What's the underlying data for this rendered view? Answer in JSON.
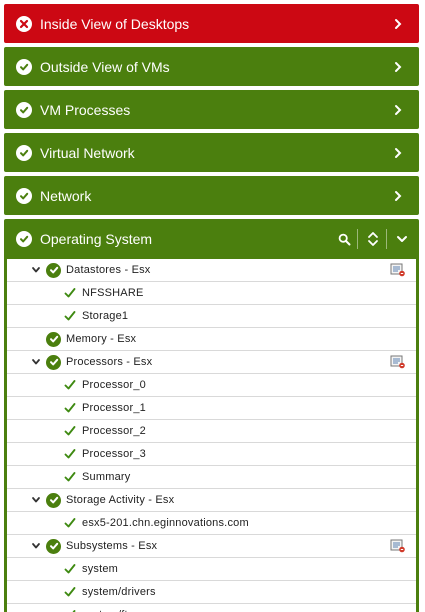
{
  "sections": [
    {
      "label": "Inside View of Desktops",
      "status": "error"
    },
    {
      "label": "Outside View of VMs",
      "status": "ok"
    },
    {
      "label": "VM Processes",
      "status": "ok"
    },
    {
      "label": "Virtual Network",
      "status": "ok"
    },
    {
      "label": "Network",
      "status": "ok"
    }
  ],
  "expanded_section": {
    "label": "Operating System",
    "status": "ok",
    "tools": [
      "search-icon",
      "sort-icon",
      "collapse-chevron-icon"
    ]
  },
  "tree": [
    {
      "label": "Datastores - Esx",
      "level": 1,
      "expandable": true,
      "report_icon": true
    },
    {
      "label": "NFSSHARE",
      "level": 2
    },
    {
      "label": "Storage1",
      "level": 2
    },
    {
      "label": "Memory - Esx",
      "level": 1,
      "expandable": false,
      "report_icon": false
    },
    {
      "label": "Processors - Esx",
      "level": 1,
      "expandable": true,
      "report_icon": true
    },
    {
      "label": "Processor_0",
      "level": 2
    },
    {
      "label": "Processor_1",
      "level": 2
    },
    {
      "label": "Processor_2",
      "level": 2
    },
    {
      "label": "Processor_3",
      "level": 2
    },
    {
      "label": "Summary",
      "level": 2
    },
    {
      "label": "Storage Activity - Esx",
      "level": 1,
      "expandable": true,
      "report_icon": false
    },
    {
      "label": "esx5-201.chn.eginnovations.com",
      "level": 2
    },
    {
      "label": "Subsystems - Esx",
      "level": 1,
      "expandable": true,
      "report_icon": true
    },
    {
      "label": "system",
      "level": 2
    },
    {
      "label": "system/drivers",
      "level": 2
    },
    {
      "label": "system/ft",
      "level": 2
    }
  ],
  "colors": {
    "ok_green": "#4b7f0e",
    "error_red": "#cc0813",
    "tick_green": "#3f8a12"
  }
}
